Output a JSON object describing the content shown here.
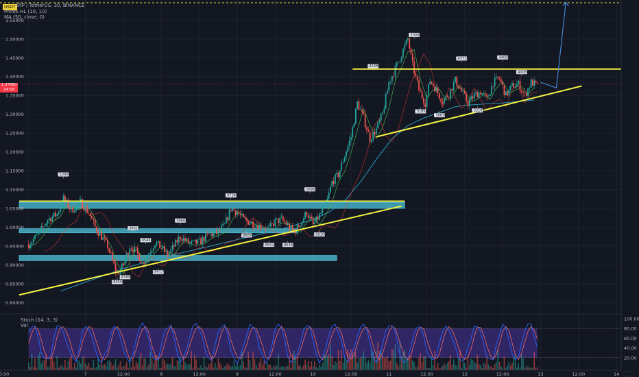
{
  "header": {
    "symbol_line": "XRP / TetherUS, 30, BINANCE",
    "indicator_pivots": "Pivots HL (10, 10)",
    "indicator_ma": "MA (50, close, 0)",
    "top_badge": "USDT"
  },
  "price_tag": {
    "price": "1.37860",
    "countdown": "14:59"
  },
  "stoch_panel": {
    "label": "Stoch (14, 3, 3)",
    "vol_label": "Vol"
  },
  "colors": {
    "background": "#131722",
    "up": "#26a69a",
    "down": "#ef5350",
    "trendline": "#f5f542",
    "zone": "#4fc3d9",
    "ma": "#2aa7c9",
    "forecast": "#4a90e2",
    "stoch_k": "#2962ff",
    "stoch_d": "#ef6c6c",
    "stoch_band": "#3c2c7c"
  },
  "chart_data": {
    "type": "candlestick",
    "title": "XRP / TetherUS, 30, BINANCE",
    "price_ticks": [
      "1.55000",
      "1.50000",
      "1.45000",
      "1.40000",
      "1.35000",
      "1.30000",
      "1.25000",
      "1.20000",
      "1.15000",
      "1.10000",
      "1.05000",
      "1.00000",
      "0.95000",
      "0.90000",
      "0.85000",
      "0.80000"
    ],
    "price_tick_values": [
      1.55,
      1.5,
      1.45,
      1.4,
      1.35,
      1.3,
      1.25,
      1.2,
      1.15,
      1.1,
      1.05,
      1.0,
      0.95,
      0.9,
      0.85,
      0.8
    ],
    "ylim": [
      0.775,
      1.598
    ],
    "time_ticks": [
      {
        "label": "0:00",
        "t": 0
      },
      {
        "label": "7",
        "t": 36
      },
      {
        "label": "12:00",
        "t": 60
      },
      {
        "label": "8",
        "t": 84
      },
      {
        "label": "12:00",
        "t": 108
      },
      {
        "label": "9",
        "t": 132
      },
      {
        "label": "12:00",
        "t": 156
      },
      {
        "label": "10",
        "t": 180
      },
      {
        "label": "12:00",
        "t": 204
      },
      {
        "label": "11",
        "t": 228
      },
      {
        "label": "12:00",
        "t": 252
      },
      {
        "label": "12",
        "t": 276
      },
      {
        "label": "12:00",
        "t": 300
      },
      {
        "label": "13",
        "t": 324
      },
      {
        "label": "12:00",
        "t": 348
      },
      {
        "label": "14",
        "t": 372
      }
    ],
    "close_path": [
      [
        0,
        0.955
      ],
      [
        6,
        0.98
      ],
      [
        12,
        1.02
      ],
      [
        18,
        1.035
      ],
      [
        22,
        1.075
      ],
      [
        27,
        1.045
      ],
      [
        33,
        1.065
      ],
      [
        38,
        1.04
      ],
      [
        42,
        1.0
      ],
      [
        46,
        0.975
      ],
      [
        50,
        0.95
      ],
      [
        53,
        0.91
      ],
      [
        56,
        0.875
      ],
      [
        60,
        0.9
      ],
      [
        64,
        0.95
      ],
      [
        68,
        0.935
      ],
      [
        72,
        0.905
      ],
      [
        76,
        0.93
      ],
      [
        80,
        0.96
      ],
      [
        84,
        0.945
      ],
      [
        88,
        0.925
      ],
      [
        92,
        0.95
      ],
      [
        96,
        0.975
      ],
      [
        102,
        0.955
      ],
      [
        108,
        0.96
      ],
      [
        114,
        0.98
      ],
      [
        120,
        0.985
      ],
      [
        124,
        1.005
      ],
      [
        128,
        1.05
      ],
      [
        132,
        1.04
      ],
      [
        136,
        1.02
      ],
      [
        142,
        1.01
      ],
      [
        148,
        1.0
      ],
      [
        152,
        0.995
      ],
      [
        156,
        1.015
      ],
      [
        160,
        1.02
      ],
      [
        164,
        1.005
      ],
      [
        168,
        0.985
      ],
      [
        172,
        1.01
      ],
      [
        176,
        1.04
      ],
      [
        180,
        1.005
      ],
      [
        184,
        1.03
      ],
      [
        188,
        1.055
      ],
      [
        192,
        1.12
      ],
      [
        196,
        1.14
      ],
      [
        200,
        1.19
      ],
      [
        204,
        1.24
      ],
      [
        208,
        1.33
      ],
      [
        212,
        1.29
      ],
      [
        216,
        1.235
      ],
      [
        220,
        1.26
      ],
      [
        224,
        1.3
      ],
      [
        228,
        1.385
      ],
      [
        232,
        1.42
      ],
      [
        236,
        1.46
      ],
      [
        240,
        1.5
      ],
      [
        243,
        1.43
      ],
      [
        247,
        1.365
      ],
      [
        251,
        1.33
      ],
      [
        254,
        1.39
      ],
      [
        258,
        1.365
      ],
      [
        262,
        1.335
      ],
      [
        266,
        1.355
      ],
      [
        270,
        1.39
      ],
      [
        274,
        1.36
      ],
      [
        278,
        1.33
      ],
      [
        282,
        1.35
      ],
      [
        286,
        1.36
      ],
      [
        290,
        1.34
      ],
      [
        294,
        1.385
      ],
      [
        298,
        1.395
      ],
      [
        302,
        1.35
      ],
      [
        306,
        1.375
      ],
      [
        310,
        1.38
      ],
      [
        314,
        1.35
      ],
      [
        318,
        1.385
      ],
      [
        322,
        1.375
      ]
    ],
    "ma50_path": [
      [
        20,
        0.83
      ],
      [
        40,
        0.86
      ],
      [
        60,
        0.89
      ],
      [
        80,
        0.915
      ],
      [
        100,
        0.935
      ],
      [
        120,
        0.955
      ],
      [
        140,
        0.975
      ],
      [
        160,
        0.995
      ],
      [
        180,
        1.02
      ],
      [
        190,
        1.04
      ],
      [
        200,
        1.07
      ],
      [
        210,
        1.12
      ],
      [
        220,
        1.18
      ],
      [
        230,
        1.235
      ],
      [
        240,
        1.27
      ],
      [
        250,
        1.29
      ],
      [
        260,
        1.305
      ],
      [
        270,
        1.32
      ],
      [
        280,
        1.325
      ],
      [
        300,
        1.33
      ],
      [
        320,
        1.338
      ]
    ],
    "pivots": [
      {
        "t": 22,
        "price": 1.12904,
        "label": "1.12904",
        "pos": "high"
      },
      {
        "t": 56,
        "price": 0.86506,
        "label": "0.86506",
        "pos": "low"
      },
      {
        "t": 66,
        "price": 0.9861,
        "label": "0.98610",
        "pos": "high"
      },
      {
        "t": 74,
        "price": 0.95462,
        "label": "0.95462",
        "pos": "high"
      },
      {
        "t": 61,
        "price": 0.87808,
        "label": "0.87808",
        "pos": "low"
      },
      {
        "t": 82,
        "price": 0.89129,
        "label": "0.89129",
        "pos": "low"
      },
      {
        "t": 96,
        "price": 1.00666,
        "label": "1.00666",
        "pos": "high"
      },
      {
        "t": 128,
        "price": 1.07344,
        "label": "1.07344",
        "pos": "high"
      },
      {
        "t": 138,
        "price": 0.98892,
        "label": "0.98892",
        "pos": "low"
      },
      {
        "t": 152,
        "price": 0.96422,
        "label": "0.96422",
        "pos": "low"
      },
      {
        "t": 164,
        "price": 0.96382,
        "label": "0.96382",
        "pos": "low"
      },
      {
        "t": 178,
        "price": 1.08965,
        "label": "1.08965",
        "pos": "high"
      },
      {
        "t": 184,
        "price": 0.99166,
        "label": "0.99166",
        "pos": "low"
      },
      {
        "t": 218,
        "price": 1.41688,
        "label": "1.41688",
        "pos": "high"
      },
      {
        "t": 244,
        "price": 1.5,
        "label": "1.50000",
        "pos": "high"
      },
      {
        "t": 248,
        "price": 1.3185,
        "label": "1.31850",
        "pos": "low"
      },
      {
        "t": 260,
        "price": 1.3083,
        "label": "1.30830",
        "pos": "low"
      },
      {
        "t": 274,
        "price": 1.4371,
        "label": "1.43710",
        "pos": "high"
      },
      {
        "t": 284,
        "price": 1.32105,
        "label": "1.32105",
        "pos": "low"
      },
      {
        "t": 300,
        "price": 1.44,
        "label": "1.44000",
        "pos": "high"
      },
      {
        "t": 312,
        "price": 1.40087,
        "label": "1.40087",
        "pos": "high"
      }
    ],
    "lines": [
      {
        "name": "support-lower",
        "t1": -6,
        "p1": 0.82,
        "t2": 236,
        "p2": 1.056
      },
      {
        "name": "resistance-lower",
        "t1": -6,
        "p1": 1.069,
        "t2": 238,
        "p2": 1.069
      },
      {
        "name": "support-upper",
        "t1": 220,
        "p1": 1.24,
        "t2": 350,
        "p2": 1.375
      },
      {
        "name": "resistance-upper",
        "t1": 205,
        "p1": 1.42,
        "t2": 375,
        "p2": 1.42
      }
    ],
    "zones": [
      {
        "name": "zone-1",
        "t1": -6,
        "t2": 238,
        "low": 1.05,
        "high": 1.066
      },
      {
        "name": "zone-2",
        "t1": -6,
        "t2": 170,
        "low": 0.985,
        "high": 0.996
      },
      {
        "name": "zone-3",
        "t1": -6,
        "t2": 195,
        "low": 0.911,
        "high": 0.925
      }
    ],
    "forecast": [
      [
        324,
        1.385
      ],
      [
        334,
        1.37
      ],
      [
        340,
        1.598
      ]
    ],
    "stoch_ticks": [
      "100.00",
      "80.00",
      "60.00",
      "40.00",
      "20.00"
    ],
    "stoch_tick_values": [
      100,
      80,
      60,
      40,
      20
    ],
    "stoch_band": [
      20,
      80
    ]
  }
}
